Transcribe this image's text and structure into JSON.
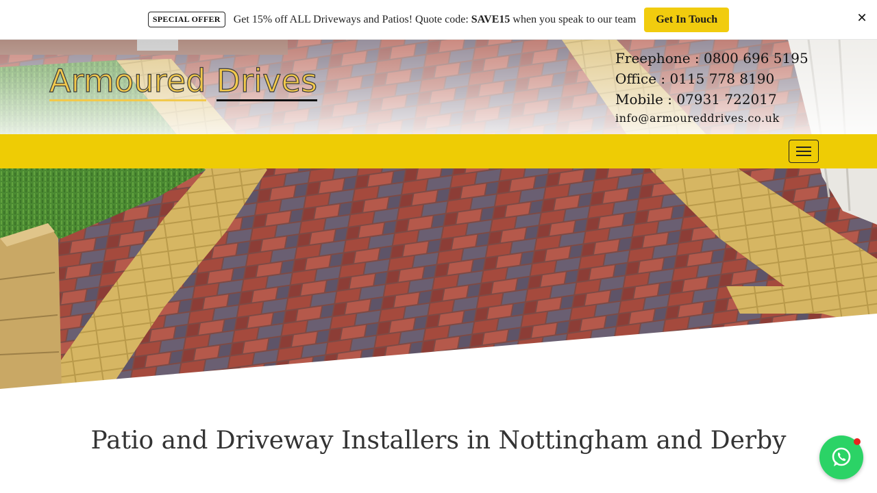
{
  "offer_bar": {
    "badge": "SPECIAL OFFER",
    "text_before": "Get 15% off ALL Driveways and Patios! Quote code: ",
    "code": "SAVE15",
    "text_after": " when you speak to our team",
    "cta_label": "Get In Touch",
    "close_label": "✕",
    "cta_color": "#f1cc0e"
  },
  "header": {
    "logo_word_1": "Armoured",
    "logo_word_2": "Drives",
    "freephone": "Freephone : 0800 696 5195",
    "office": "Office : 0115 778 8190",
    "mobile": "Mobile : 07931 722017",
    "email": "info@armoureddrives.co.uk"
  },
  "nav": {
    "menu_icon": "hamburger-menu-icon",
    "bar_color": "#eecc05"
  },
  "main": {
    "heading": "Patio and Driveway Installers in Nottingham and Derby"
  },
  "chat": {
    "icon": "whatsapp-icon",
    "color": "#2bd366",
    "notification_color": "#e8231e"
  }
}
